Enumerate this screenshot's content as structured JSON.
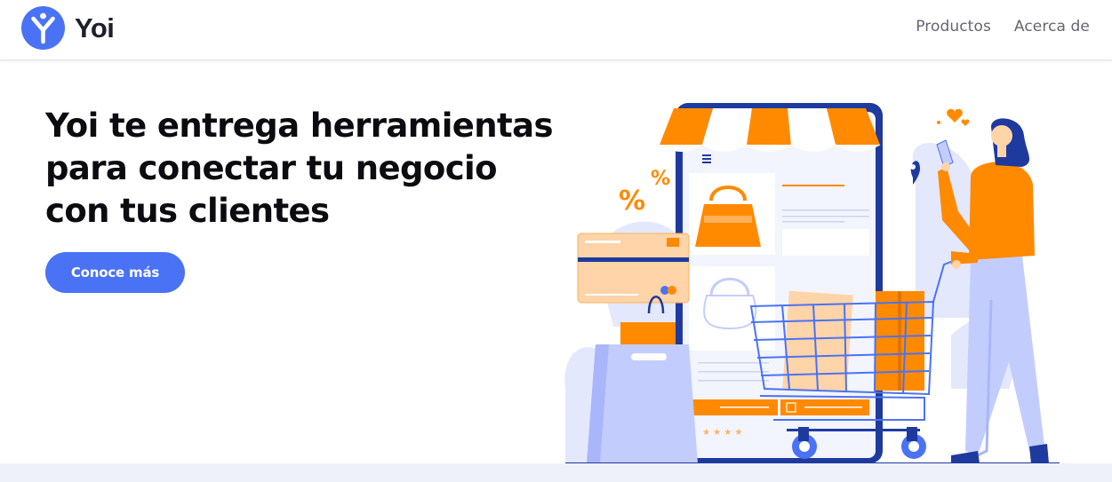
{
  "brand": {
    "name": "Yoi"
  },
  "nav": {
    "items": [
      {
        "label": "Productos"
      },
      {
        "label": "Acerca de"
      }
    ]
  },
  "hero": {
    "title": "Yoi te entrega herramientas para conectar tu negocio con tus clientes",
    "cta_label": "Conoce más"
  },
  "illustration": {
    "percent_labels": [
      "%",
      "%"
    ]
  },
  "colors": {
    "accent": "#4a72f5",
    "orange": "#ff8a00",
    "navy": "#1f3a9e",
    "periwinkle": "#c3cdfd"
  }
}
